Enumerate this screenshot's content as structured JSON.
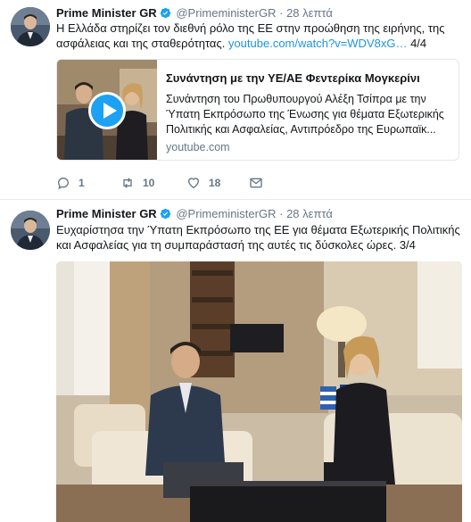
{
  "tweets": [
    {
      "author_name": "Prime Minister GR",
      "handle": "@PrimeministerGR",
      "separator": "·",
      "time": "28 λεπτά",
      "text": "Η Ελλάδα στηρίζει τον διεθνή ρόλο της ΕΕ στην προώθηση της ειρήνης, της ασφάλειας και της σταθερότητας.",
      "link": "youtube.com/watch?v=WDV8xG…",
      "thread_count": "4/4",
      "card": {
        "title": "Συνάντηση με την ΥΕ/ΑΕ Φεντερίκα Μογκερίνι",
        "description": "Συνάντηση του Πρωθυπουργού Αλέξη Τσίπρα με την Ύπατη Εκπρόσωπο της Ένωσης για θέματα Εξωτερικής Πολιτικής και Ασφαλείας, Αντιπρόεδρο της Ευρωπαϊκ...",
        "domain": "youtube.com"
      },
      "actions": {
        "replies": "1",
        "retweets": "10",
        "likes": "18"
      }
    },
    {
      "author_name": "Prime Minister GR",
      "handle": "@PrimeministerGR",
      "separator": "·",
      "time": "28 λεπτά",
      "text": "Ευχαρίστησα την Ύπατη Εκπρόσωπο της ΕΕ για θέματα Εξωτερικής Πολιτικής και Ασφαλείας για τη συμπαράστασή της αυτές τις δύσκολες ώρες.",
      "thread_count": "3/4"
    }
  ],
  "colors": {
    "link": "#1b95e0",
    "muted": "#657786",
    "verified": "#1da1f2",
    "divider": "#e6ecf0"
  },
  "icons": [
    "verified-badge-icon",
    "play-icon",
    "reply-icon",
    "retweet-icon",
    "like-icon",
    "direct-message-icon"
  ]
}
